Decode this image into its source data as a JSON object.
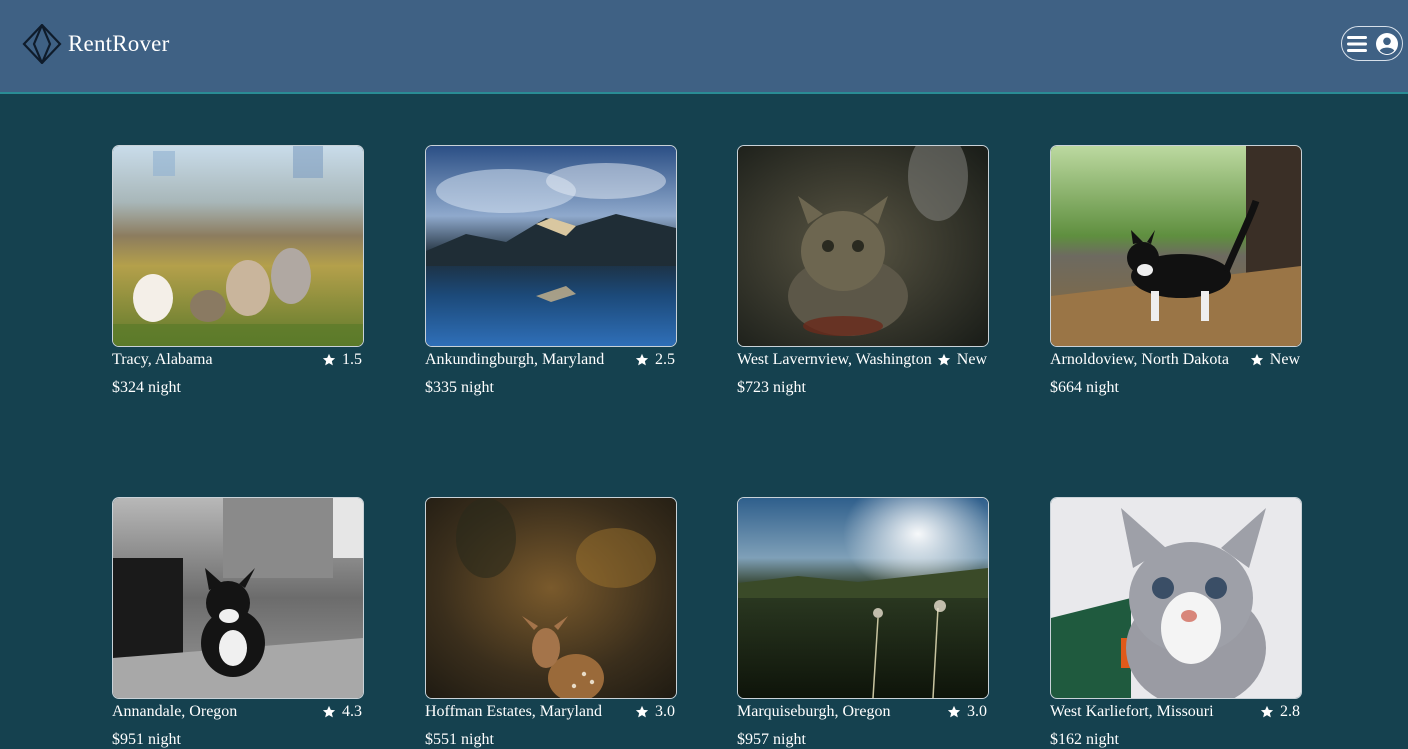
{
  "app": {
    "name": "RentRover"
  },
  "header": {
    "logo_icon": "diamond-logo-icon",
    "menu_icon": "hamburger-menu-icon",
    "user_icon": "user-circle-icon"
  },
  "listings": [
    {
      "location": "Tracy, Alabama",
      "rating": "1.5",
      "price": "$324 night",
      "image": "persian-cats-in-meadow"
    },
    {
      "location": "Ankundingburgh, Maryland",
      "rating": "2.5",
      "price": "$335 night",
      "image": "mountain-lake-reflection"
    },
    {
      "location": "West Lavernview, Washington",
      "rating": "New",
      "price": "$723 night",
      "image": "fluffy-tabby-kitten"
    },
    {
      "location": "Arnoldoview, North Dakota",
      "rating": "New",
      "price": "$664 night",
      "image": "black-white-kitten-on-table"
    },
    {
      "location": "Annandale, Oregon",
      "rating": "4.3",
      "price": "$951 night",
      "image": "bw-kitten-on-carpet"
    },
    {
      "location": "Hoffman Estates, Maryland",
      "rating": "3.0",
      "price": "$551 night",
      "image": "fawn-in-forest"
    },
    {
      "location": "Marquiseburgh, Oregon",
      "rating": "3.0",
      "price": "$957 night",
      "image": "sunlit-meadow"
    },
    {
      "location": "West Karliefort, Missouri",
      "rating": "2.8",
      "price": "$162 night",
      "image": "grey-white-kitten-closeup"
    }
  ],
  "colors": {
    "header_bg": "#3f6184",
    "page_bg": "#15414f",
    "accent": "#2a8c95"
  }
}
